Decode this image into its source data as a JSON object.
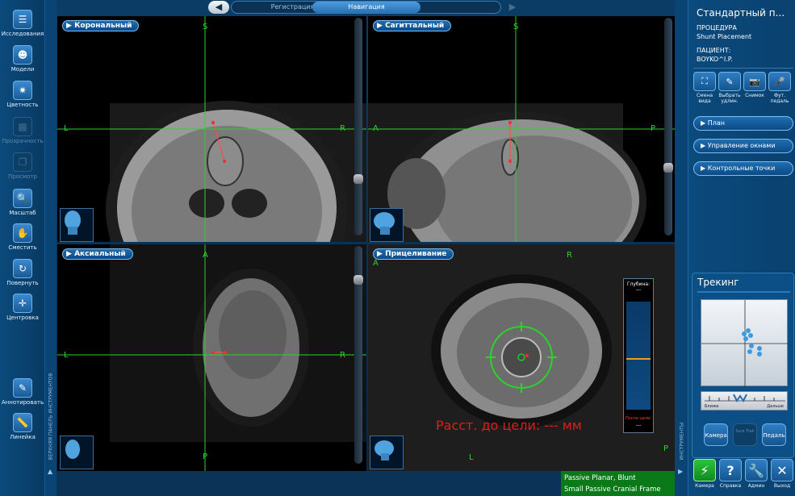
{
  "nav": {
    "back_label": "◀",
    "tabs": [
      {
        "label": "Регистрация",
        "active": false
      },
      {
        "label": "Навигация",
        "active": true
      }
    ],
    "forward_label": "▶"
  },
  "left_tools": [
    {
      "icon": "list-icon",
      "glyph": "☰",
      "label": "Исследования",
      "enabled": true
    },
    {
      "icon": "head-icon",
      "glyph": "☻",
      "label": "Модели",
      "enabled": true
    },
    {
      "icon": "color-icon",
      "glyph": "✷",
      "label": "Цветность",
      "enabled": true
    },
    {
      "icon": "transparency-icon",
      "glyph": "▩",
      "label": "Прозрачность",
      "enabled": false
    },
    {
      "icon": "views-icon",
      "glyph": "❐",
      "label": "Просмотр",
      "enabled": false
    },
    {
      "icon": "zoom-icon",
      "glyph": "🔍",
      "label": "Масштаб",
      "enabled": true
    },
    {
      "icon": "pan-icon",
      "glyph": "✋",
      "label": "Сместить",
      "enabled": true
    },
    {
      "icon": "rotate-icon",
      "glyph": "↻",
      "label": "Повернуть",
      "enabled": true
    },
    {
      "icon": "center-icon",
      "glyph": "✛",
      "label": "Центровка",
      "enabled": true
    },
    {
      "icon": "annotate-icon",
      "glyph": "✎",
      "label": "Аннотировать",
      "enabled": true
    },
    {
      "icon": "ruler-icon",
      "glyph": "📏",
      "label": "Линейка",
      "enabled": true
    }
  ],
  "left_strip_text": "ВЕРХНЯЯ ПАНЕЛЬ ИНСТРУМЕНТОВ",
  "right_strip_text": "ИНСТРУМЕНТЫ",
  "viewports": {
    "coronal": {
      "label": "Корональный",
      "top": "S",
      "left": "L",
      "right": "R"
    },
    "sagittal": {
      "label": "Сагиттальный",
      "top": "S",
      "left": "A",
      "right": "P"
    },
    "axial": {
      "label": "Аксиальный",
      "top": "A",
      "left": "L",
      "right": "R",
      "bottom": "P"
    },
    "targeting": {
      "label": "Прицеливание",
      "top": "R",
      "left": "A",
      "bottom": "L",
      "right": "P"
    }
  },
  "gauge": {
    "depth_label": "Глубина:",
    "depth_value": "---",
    "footer_label": "После цели:",
    "footer_value": "---",
    "indicator_color": "#f39a1b"
  },
  "distance_text": "Расст. до цели: --- мм",
  "status": {
    "line1": "Passive Planar, Blunt",
    "line2": "Small Passive Cranial Frame"
  },
  "right": {
    "title": "Стандартный п...",
    "procedure_label": "ПРОЦЕДУРА",
    "procedure_value": "Shunt Placement",
    "patient_label": "ПАЦИЕНТ:",
    "patient_value": "BOYKO^I.P.",
    "quick_buttons": [
      {
        "icon": "view-change-icon",
        "glyph": "⛶",
        "label": "Смена вида"
      },
      {
        "icon": "tool-select-icon",
        "glyph": "✎",
        "label": "Выбрать удлин."
      },
      {
        "icon": "camera-icon",
        "glyph": "📷",
        "label": "Снимок"
      },
      {
        "icon": "microphone-icon",
        "glyph": "🎤",
        "label": "Фут. педаль"
      }
    ],
    "expanders": [
      "План",
      "Управление окнами",
      "Контрольные точки"
    ],
    "tracking_title": "Трекинг",
    "ruler_left": "Ближе",
    "ruler_right": "Дальше",
    "tracking_buttons": [
      {
        "label": "Камера",
        "enabled": true
      },
      {
        "label": "Sure Trak",
        "enabled": false
      },
      {
        "label": "Педаль",
        "enabled": true
      }
    ],
    "bottom_buttons": [
      {
        "icon": "camera-tool-icon",
        "glyph": "⚡",
        "label": "Камера",
        "green": true
      },
      {
        "icon": "help-icon",
        "glyph": "?",
        "label": "Справка",
        "green": false
      },
      {
        "icon": "wrench-icon",
        "glyph": "🔧",
        "label": "Админ",
        "green": false
      },
      {
        "icon": "close-icon",
        "glyph": "✕",
        "label": "Выход",
        "green": false
      }
    ]
  }
}
